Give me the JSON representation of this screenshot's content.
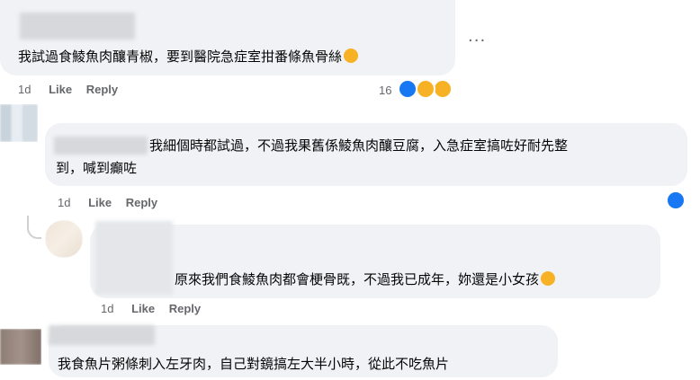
{
  "comments": [
    {
      "text": "我試過食鯪魚肉釀青椒，要到醫院急症室拑番條魚骨絲",
      "time": "1d",
      "like": "Like",
      "reply": "Reply",
      "reaction_count": "16",
      "reactions": [
        "like-icon",
        "wow-icon",
        "sad-icon"
      ],
      "emoji": "downcast-face"
    },
    {
      "text_line1": "我細個時都試過，不過我果舊係鯪魚肉釀豆腐，入急症室搞咗好耐先整",
      "text_line2": "到，喊到癲咗",
      "time": "1d",
      "like": "Like",
      "reply": "Reply",
      "reactions": [
        "like-icon"
      ]
    },
    {
      "text": "原來我們食鯪魚肉都會梗骨既，不過我已成年，妳還是小女孩",
      "time": "1d",
      "like": "Like",
      "reply": "Reply",
      "emoji": "laughing-tears-face"
    },
    {
      "text": "我食魚片粥條刺入左牙肉，自己對鏡搞左大半小時，從此不吃魚片"
    }
  ],
  "more_options": "...",
  "colors": {
    "bubble": "#f0f2f5",
    "meta": "#65676b",
    "like_blue": "#1877f2",
    "emoji_yellow": "#f7b125"
  }
}
